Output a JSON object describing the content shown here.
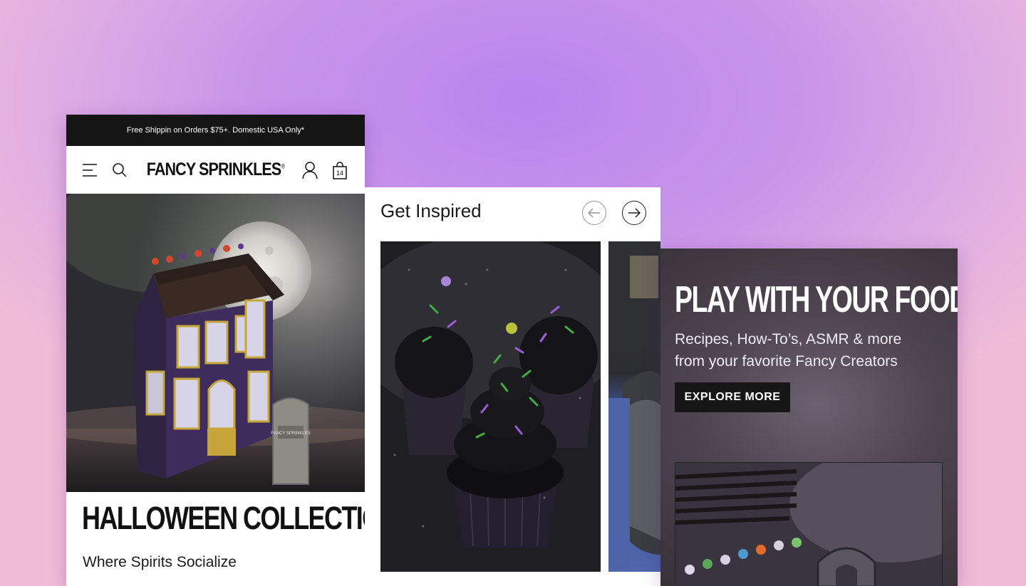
{
  "promo_bar": {
    "text": "Free Shippin on Orders $75+. Domestic USA Only*"
  },
  "nav": {
    "logo": "FANCY SPRINKLES",
    "logo_mark": "®",
    "cart_count": "14"
  },
  "hero": {
    "title": "HALLOWEEN COLLECTION",
    "subtitle": "Where Spirits Socialize",
    "tombstone_text": "FANCY SPRINKLES"
  },
  "inspire": {
    "title": "Get Inspired"
  },
  "play": {
    "title": "PLAY WITH YOUR FOOD",
    "subtitle": "Recipes, How-To’s, ASMR & more from your favorite Fancy Creators",
    "cta": "EXPLORE MORE"
  },
  "colors": {
    "background": "#c48fe9",
    "promo_bar": "#151515",
    "cta_button": "#161616",
    "play_panel": "#4d4450"
  },
  "icons": [
    "menu-icon",
    "search-icon",
    "account-icon",
    "cart-icon",
    "arrow-left-icon",
    "arrow-right-icon"
  ]
}
